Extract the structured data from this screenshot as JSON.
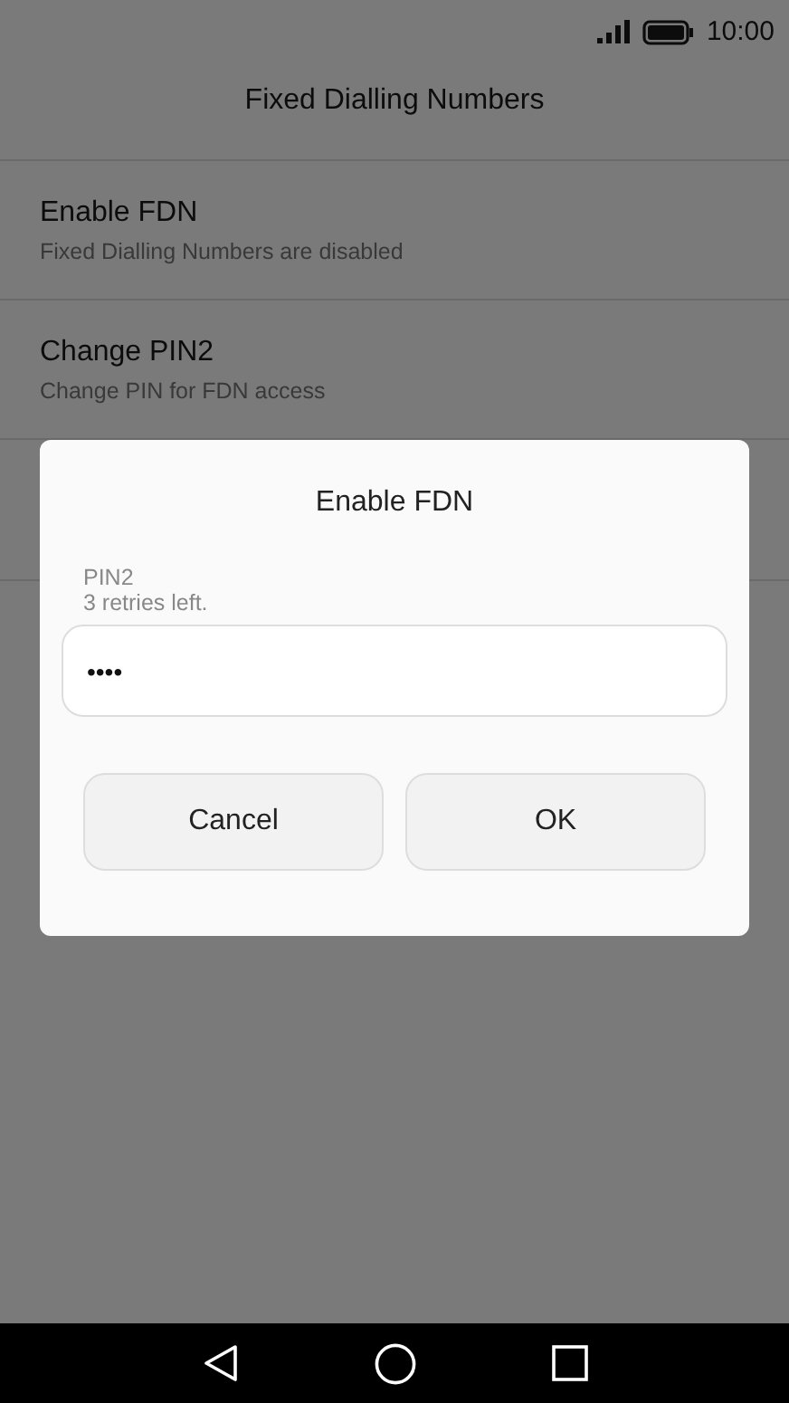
{
  "status_bar": {
    "time": "10:00"
  },
  "header": {
    "title": "Fixed Dialling Numbers"
  },
  "settings": [
    {
      "title": "Enable FDN",
      "subtitle": "Fixed Dialling Numbers are disabled"
    },
    {
      "title": "Change PIN2",
      "subtitle": "Change PIN for FDN access"
    }
  ],
  "dialog": {
    "title": "Enable FDN",
    "field_label": "PIN2",
    "hint": "3 retries left.",
    "value": "••••",
    "buttons": [
      "Cancel",
      "OK"
    ]
  }
}
